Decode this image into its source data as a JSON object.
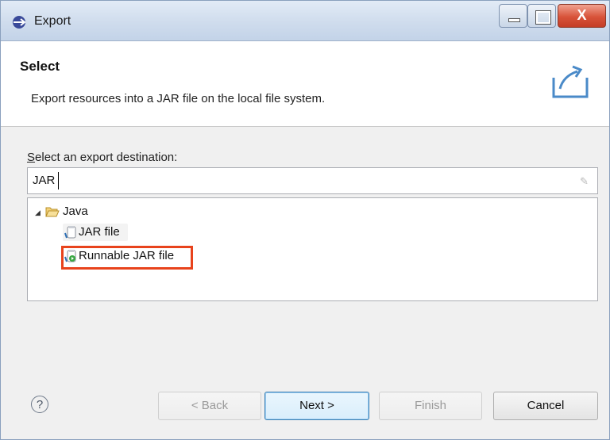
{
  "window": {
    "title": "Export",
    "close_label": "X"
  },
  "header": {
    "title": "Select",
    "description": "Export resources into a JAR file on the local file system."
  },
  "destination": {
    "label_prefix": "S",
    "label_rest": "elect an export destination:",
    "filter_value": "JAR"
  },
  "tree": {
    "folder": {
      "label": "Java",
      "expanded": true,
      "icon": "folder-open-icon"
    },
    "items": [
      {
        "label": "JAR file",
        "icon": "jar-file-icon"
      },
      {
        "label": "Runnable JAR file",
        "icon": "runnable-jar-icon",
        "highlighted": true
      }
    ]
  },
  "buttons": {
    "help": "?",
    "back": "< Back",
    "next": "Next >",
    "finish": "Finish",
    "cancel": "Cancel"
  },
  "colors": {
    "highlight_border": "#e8431c",
    "default_button_border": "#3c7fb1"
  }
}
